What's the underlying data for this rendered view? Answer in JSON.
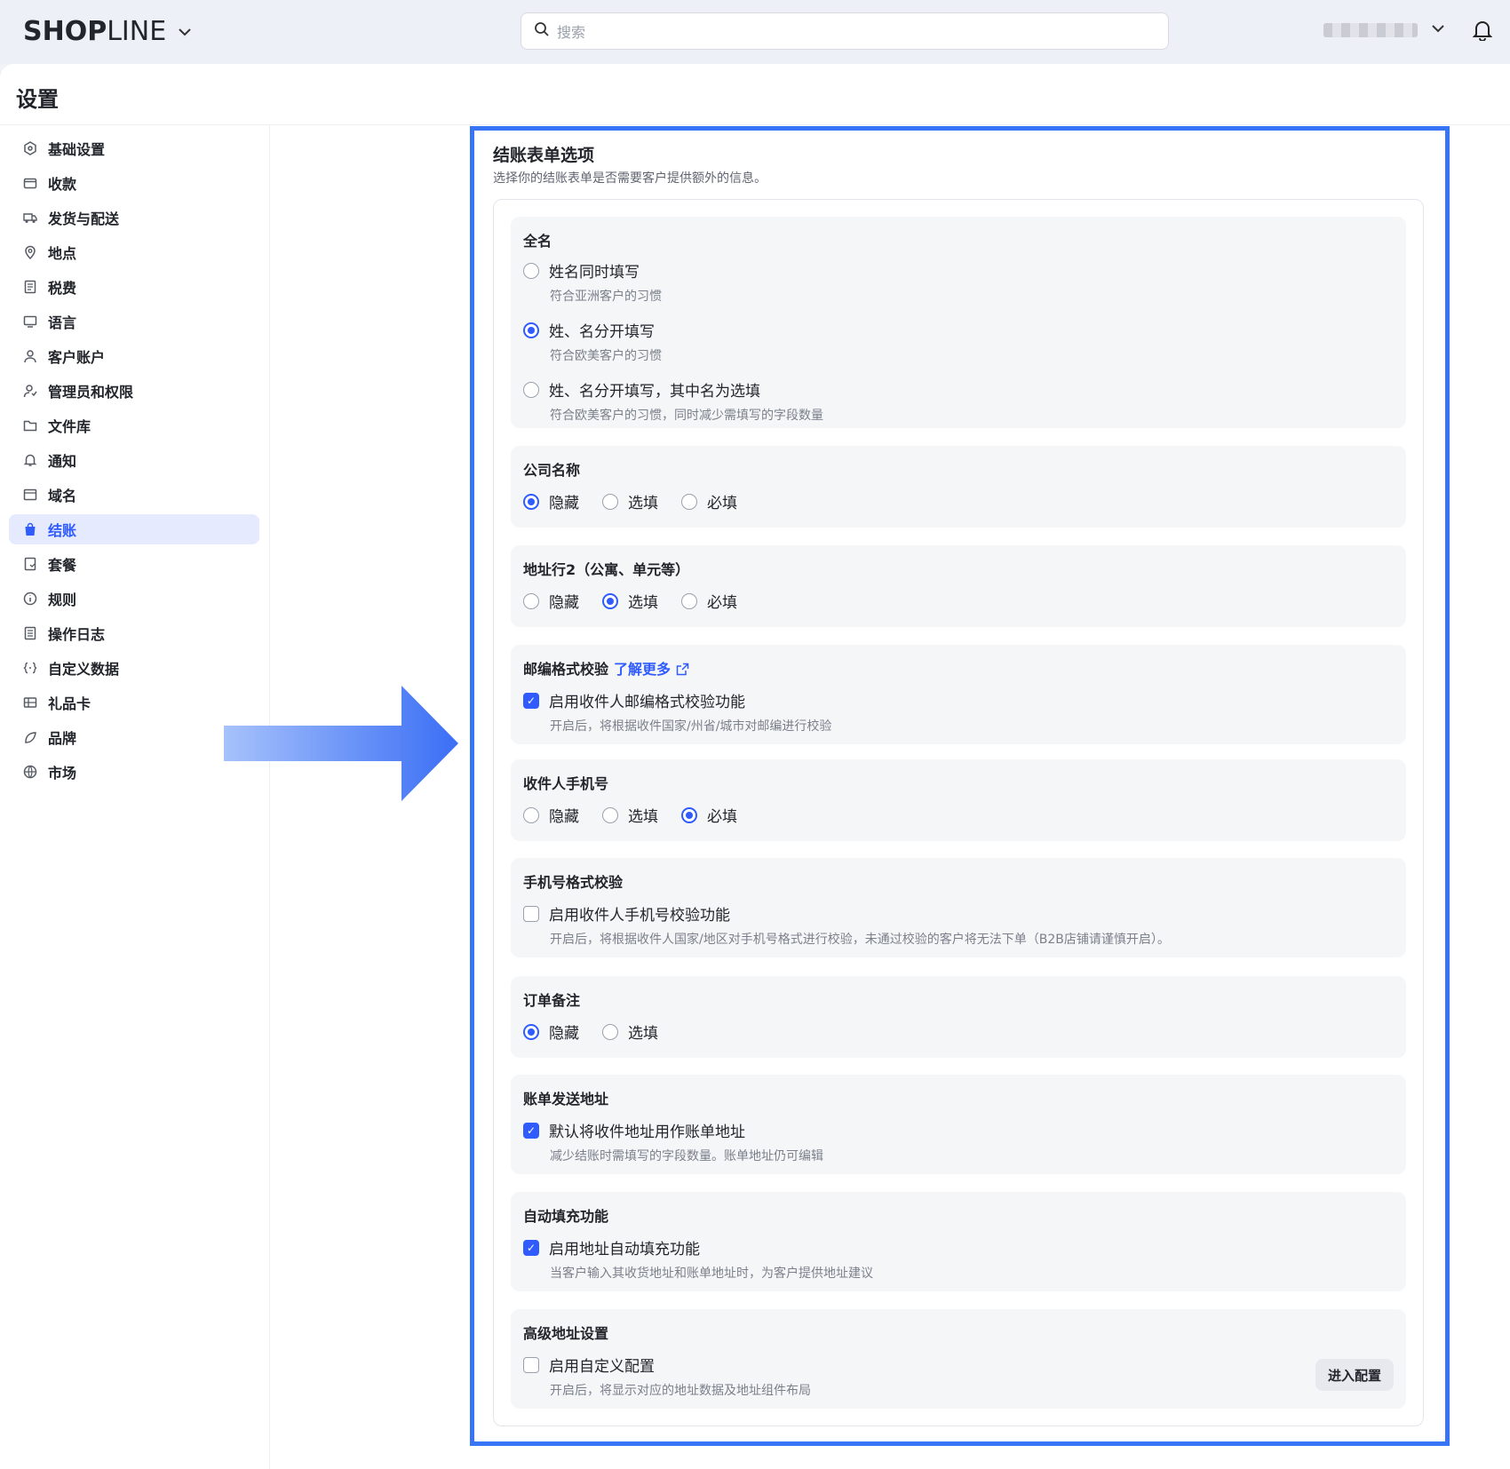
{
  "topbar": {
    "logo_bold": "SHOP",
    "logo_thin": "LINE",
    "search_placeholder": "搜索"
  },
  "page": {
    "title": "设置"
  },
  "sidebar": {
    "items": [
      {
        "label": "基础设置",
        "icon": "settings-hex-icon"
      },
      {
        "label": "收款",
        "icon": "wallet-icon"
      },
      {
        "label": "发货与配送",
        "icon": "truck-icon"
      },
      {
        "label": "地点",
        "icon": "location-pin-icon"
      },
      {
        "label": "税费",
        "icon": "receipt-icon"
      },
      {
        "label": "语言",
        "icon": "language-icon"
      },
      {
        "label": "客户账户",
        "icon": "user-icon"
      },
      {
        "label": "管理员和权限",
        "icon": "user-shield-icon"
      },
      {
        "label": "文件库",
        "icon": "folder-icon"
      },
      {
        "label": "通知",
        "icon": "bell-icon"
      },
      {
        "label": "域名",
        "icon": "domain-icon"
      },
      {
        "label": "结账",
        "icon": "shopping-bag-icon",
        "active": true
      },
      {
        "label": "套餐",
        "icon": "plan-icon"
      },
      {
        "label": "规则",
        "icon": "info-icon"
      },
      {
        "label": "操作日志",
        "icon": "log-icon"
      },
      {
        "label": "自定义数据",
        "icon": "custom-data-icon"
      },
      {
        "label": "礼品卡",
        "icon": "gift-card-icon"
      },
      {
        "label": "品牌",
        "icon": "brand-icon"
      },
      {
        "label": "市场",
        "icon": "globe-icon"
      }
    ]
  },
  "checkout_form": {
    "title": "结账表单选项",
    "description": "选择你的结账表单是否需要客户提供额外的信息。",
    "full_name": {
      "title": "全名",
      "options": [
        {
          "label": "姓名同时填写",
          "sub": "符合亚洲客户的习惯",
          "selected": false
        },
        {
          "label": "姓、名分开填写",
          "sub": "符合欧美客户的习惯",
          "selected": true
        },
        {
          "label": "姓、名分开填写，其中名为选填",
          "sub": "符合欧美客户的习惯，同时减少需填写的字段数量",
          "selected": false
        }
      ]
    },
    "company": {
      "title": "公司名称",
      "options": [
        {
          "label": "隐藏",
          "selected": true
        },
        {
          "label": "选填",
          "selected": false
        },
        {
          "label": "必填",
          "selected": false
        }
      ]
    },
    "address2": {
      "title": "地址行2（公寓、单元等）",
      "options": [
        {
          "label": "隐藏",
          "selected": false
        },
        {
          "label": "选填",
          "selected": true
        },
        {
          "label": "必填",
          "selected": false
        }
      ]
    },
    "postcode": {
      "title": "邮编格式校验",
      "link": "了解更多",
      "checkbox_label": "启用收件人邮编格式校验功能",
      "checked": true,
      "sub": "开启后，将根据收件国家/州省/城市对邮编进行校验"
    },
    "phone": {
      "title": "收件人手机号",
      "options": [
        {
          "label": "隐藏",
          "selected": false
        },
        {
          "label": "选填",
          "selected": false
        },
        {
          "label": "必填",
          "selected": true
        }
      ]
    },
    "phone_format": {
      "title": "手机号格式校验",
      "checkbox_label": "启用收件人手机号校验功能",
      "checked": false,
      "sub": "开启后，将根据收件人国家/地区对手机号格式进行校验，未通过校验的客户将无法下单（B2B店铺请谨慎开启）。"
    },
    "order_note": {
      "title": "订单备注",
      "options": [
        {
          "label": "隐藏",
          "selected": true
        },
        {
          "label": "选填",
          "selected": false
        }
      ]
    },
    "billing": {
      "title": "账单发送地址",
      "checkbox_label": "默认将收件地址用作账单地址",
      "checked": true,
      "sub": "减少结账时需填写的字段数量。账单地址仍可编辑"
    },
    "autofill": {
      "title": "自动填充功能",
      "checkbox_label": "启用地址自动填充功能",
      "checked": true,
      "sub": "当客户输入其收货地址和账单地址时，为客户提供地址建议"
    },
    "advanced": {
      "title": "高级地址设置",
      "checkbox_label": "启用自定义配置",
      "checked": false,
      "sub": "开启后，将显示对应的地址数据及地址组件布局",
      "button": "进入配置"
    }
  },
  "colors": {
    "accent": "#2f5bff",
    "highlight_border": "#3875f6"
  }
}
